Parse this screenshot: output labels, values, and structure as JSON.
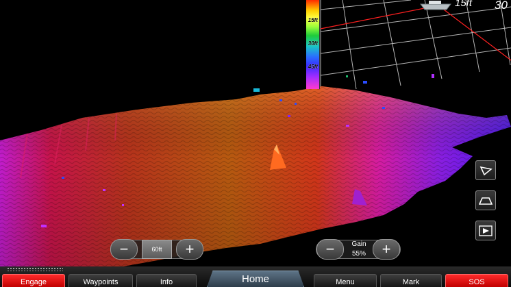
{
  "depth_scale": {
    "ticks": [
      "15ft",
      "30ft",
      "45ft"
    ]
  },
  "top_right": {
    "depth_a": "15ft",
    "depth_b": "30"
  },
  "range_control": {
    "value": "60ft",
    "minus": "−",
    "plus": "+"
  },
  "gain_control": {
    "label": "Gain",
    "value": "55%",
    "minus": "−",
    "plus": "+"
  },
  "side_buttons": [
    "view-angle-1-icon",
    "view-angle-2-icon",
    "view-flat-icon"
  ],
  "bottom_menu": {
    "engage": "Engage",
    "waypoints": "Waypoints",
    "info": "Info",
    "home": "Home",
    "menu": "Menu",
    "mark": "Mark",
    "sos": "SOS"
  },
  "colors": {
    "accent_red": "#e00000",
    "home_tab": "#4a6072"
  }
}
